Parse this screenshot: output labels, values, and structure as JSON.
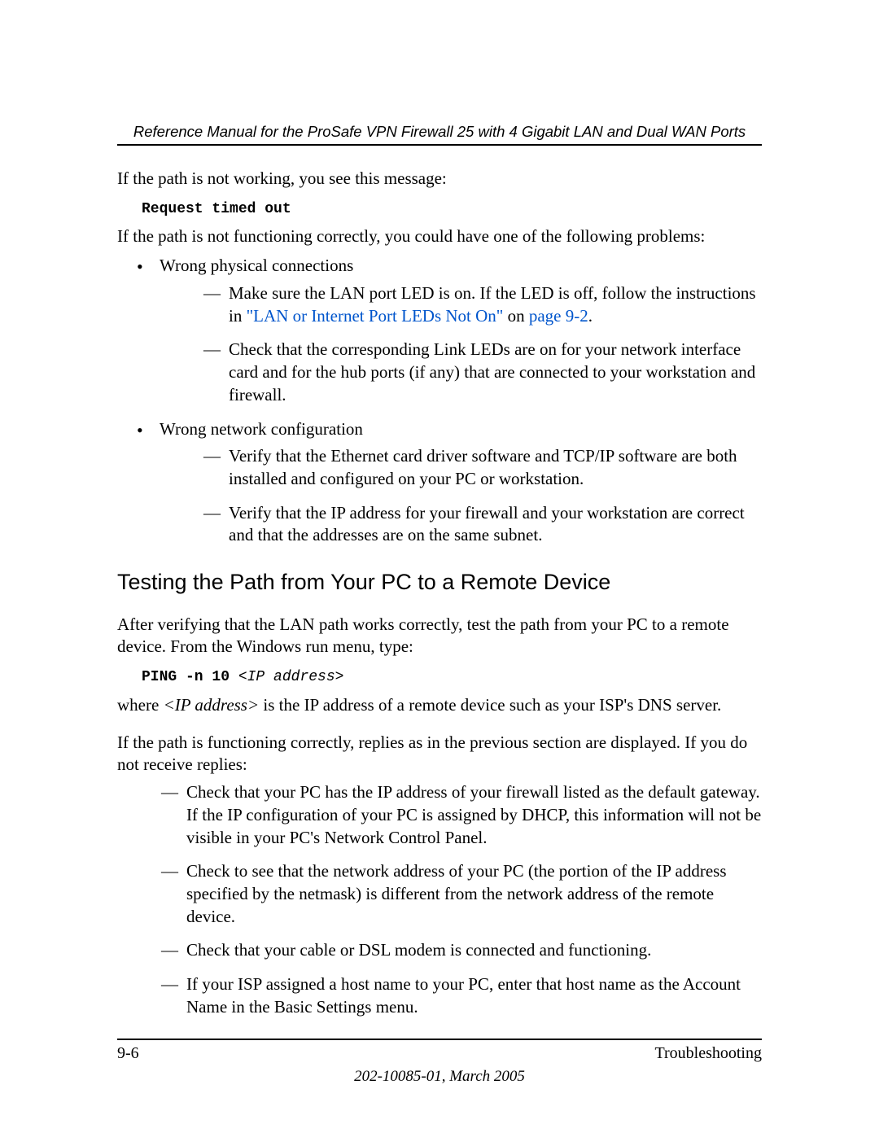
{
  "header": {
    "title": "Reference Manual for the ProSafe VPN Firewall 25 with 4 Gigabit LAN and Dual WAN Ports"
  },
  "intro": {
    "line1": "If the path is not working, you see this message:",
    "code": "Request timed out",
    "line2": "If the path is not functioning correctly, you could have one of the following problems:"
  },
  "bullets": [
    {
      "label": "Wrong physical connections",
      "items": [
        {
          "pre": "Make sure the LAN port LED is on. If the LED is off, follow the instructions in ",
          "link1": "\"LAN or Internet Port LEDs Not On\"",
          "mid": " on ",
          "link2": "page 9-2",
          "post": "."
        },
        {
          "pre": "Check that the corresponding Link LEDs are on for your network interface card and for the hub ports (if any) that are connected to your workstation and firewall."
        }
      ]
    },
    {
      "label": "Wrong network configuration",
      "items": [
        {
          "pre": "Verify that the Ethernet card driver software and TCP/IP software are both installed and configured on your PC or workstation."
        },
        {
          "pre": "Verify that the IP address for your firewall and your workstation are correct and that the addresses are on the same subnet."
        }
      ]
    }
  ],
  "section": {
    "heading": "Testing the Path from Your PC to a Remote Device",
    "p1": "After verifying that the LAN path works correctly, test the path from your PC to a remote device. From the Windows run menu, type:",
    "cmd_bold": "PING -n 10 ",
    "cmd_ital": "<IP address>",
    "p2_pre": "where ",
    "p2_ital": "<IP address>",
    "p2_post": " is the IP address of a remote device such as your ISP's DNS server.",
    "p3": "If the path is functioning correctly, replies as in the previous section are displayed. If you do not receive replies:",
    "dashes": [
      "Check that your PC has the IP address of your firewall listed as the default gateway. If the IP configuration of your PC is assigned by DHCP, this information will not be visible in your PC's Network Control Panel.",
      "Check to see that the network address of your PC (the portion of the IP address specified by the netmask) is different from the network address of the remote device.",
      "Check that your cable or DSL modem is connected and functioning.",
      "If your ISP assigned a host name to your PC, enter that host name as the Account Name in the Basic Settings menu."
    ]
  },
  "footer": {
    "page": "9-6",
    "section": "Troubleshooting",
    "docline": "202-10085-01, March 2005"
  }
}
